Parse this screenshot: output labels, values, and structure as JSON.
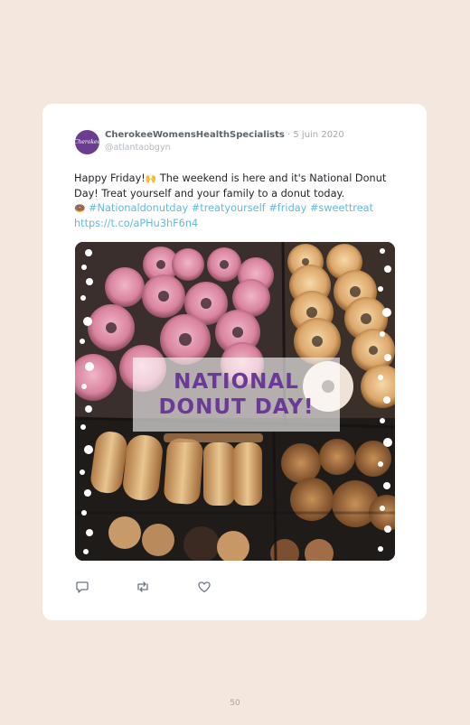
{
  "post": {
    "avatar_text": "Cherokee",
    "author": "CherokeeWomensHealthSpecialists",
    "date": "· 5 juin 2020",
    "handle": "@atlantaobgyn",
    "text_part1": "Happy Friday!",
    "text_part2": " The weekend is here and it's National Donut Day! Treat yourself and your family to a donut today.",
    "hashtags": [
      "#Nationaldonutday",
      "#treatyourself",
      "#friday",
      "#sweettreat"
    ],
    "link": "https://t.co/aPHu3hF6n4"
  },
  "image": {
    "banner_line1": "NATIONAL",
    "banner_line2": "DONUT DAY!"
  },
  "actions": {
    "icons": [
      "reply-icon",
      "retweet-icon",
      "like-icon"
    ]
  },
  "page_number": "50",
  "colors": {
    "background": "#f3e7de",
    "card": "#ffffff",
    "link": "#65b8dd",
    "banner_text": "#6a3a96"
  }
}
